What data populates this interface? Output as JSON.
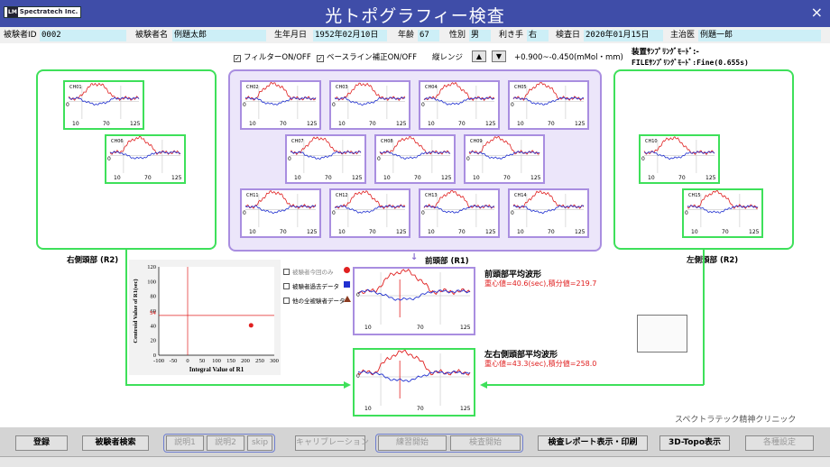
{
  "app": {
    "logo_text": "Spectratech Inc.",
    "logo_mark": "LM",
    "title": "光トポグラフィー検査",
    "close_icon": "×"
  },
  "patient": {
    "id_label": "被験者ID",
    "id_value": "0002",
    "name_label": "被験者名",
    "name_value": "例題太郎",
    "dob_label": "生年月日",
    "dob_value": "1952年02月10日",
    "age_label": "年齢",
    "age_value": "67",
    "sex_label": "性別",
    "sex_value": "男",
    "hand_label": "利き手",
    "hand_value": "右",
    "date_label": "検査日",
    "date_value": "2020年01月15日",
    "doctor_label": "主治医",
    "doctor_value": "例題一郎"
  },
  "controls": {
    "filter_label": "フィルターON/OFF",
    "baseline_label": "ベースライン補正ON/OFF",
    "range_label": "縦レンジ",
    "range_value": "+0.900~-0.450(mMol・mm)",
    "up_arrow": "▲",
    "down_arrow": "▼",
    "device_sampling": "装置ｻﾝﾌﾟﾘﾝｸﾞﾓｰﾄﾞ:-",
    "file_sampling": "FILEｻﾝﾌﾟﾘﾝｸﾞﾓｰﾄﾞ:Fine(0.655s)"
  },
  "channels": [
    "CH01",
    "CH06",
    "CH02",
    "CH03",
    "CH04",
    "CH05",
    "CH07",
    "CH08",
    "CH09",
    "CH11",
    "CH12",
    "CH13",
    "CH14",
    "CH10",
    "CH15"
  ],
  "axis_ticks": [
    "10",
    "70",
    "125"
  ],
  "zero_label": "0",
  "regions": {
    "right": "右側頭部 (R2)",
    "frontal": "前頭部 (R1)",
    "left": "左側頭部 (R2)",
    "down_arrow": "↓"
  },
  "frontal_avg": {
    "title": "前頭部平均波形",
    "values": "重心値=40.6(sec),積分値=219.7"
  },
  "lr_avg": {
    "title": "左右側頭部平均波形",
    "values": "重心値=43.3(sec),積分値=258.0"
  },
  "scatter_legend": {
    "item1": "被験者今回のみ",
    "item2": "被験者過去データ",
    "item3": "他の全被験者データ"
  },
  "chart_data": {
    "type": "scatter",
    "xlabel": "Integral Value of R1",
    "ylabel": "Centroid Value of R1(sec)",
    "xlim": [
      -100,
      300
    ],
    "ylim": [
      0,
      120
    ],
    "x_ticks": [
      "-100",
      "-50",
      "0",
      "50",
      "100",
      "150",
      "200",
      "250",
      "300"
    ],
    "y_ticks": [
      "0",
      "20",
      "40",
      "60",
      "80",
      "100",
      "120"
    ],
    "ref_x": 0,
    "ref_y": 54,
    "ref_y_label": "54",
    "points": [
      {
        "x": 219.7,
        "y": 40.6
      }
    ],
    "point_color": "#e02020",
    "ref_line_color": "#e02020",
    "grid": false
  },
  "clinic": "スペクトラテック精神クリニック",
  "footer": {
    "register": "登録",
    "search": "被験者検索",
    "explain1": "説明1",
    "explain2": "説明2",
    "skip": "skip",
    "calibration": "キャリブレーション",
    "practice": "練習開始",
    "exam_start": "検査開始",
    "report": "検査レポート表示・印刷",
    "topo3d": "3D-Topo表示",
    "settings": "各種設定"
  },
  "colors": {
    "title_bg": "#3f4da8",
    "green": "#3ee05a",
    "purple": "#a98ee0",
    "oxy": "#e02020",
    "deoxy": "#2030d0"
  }
}
